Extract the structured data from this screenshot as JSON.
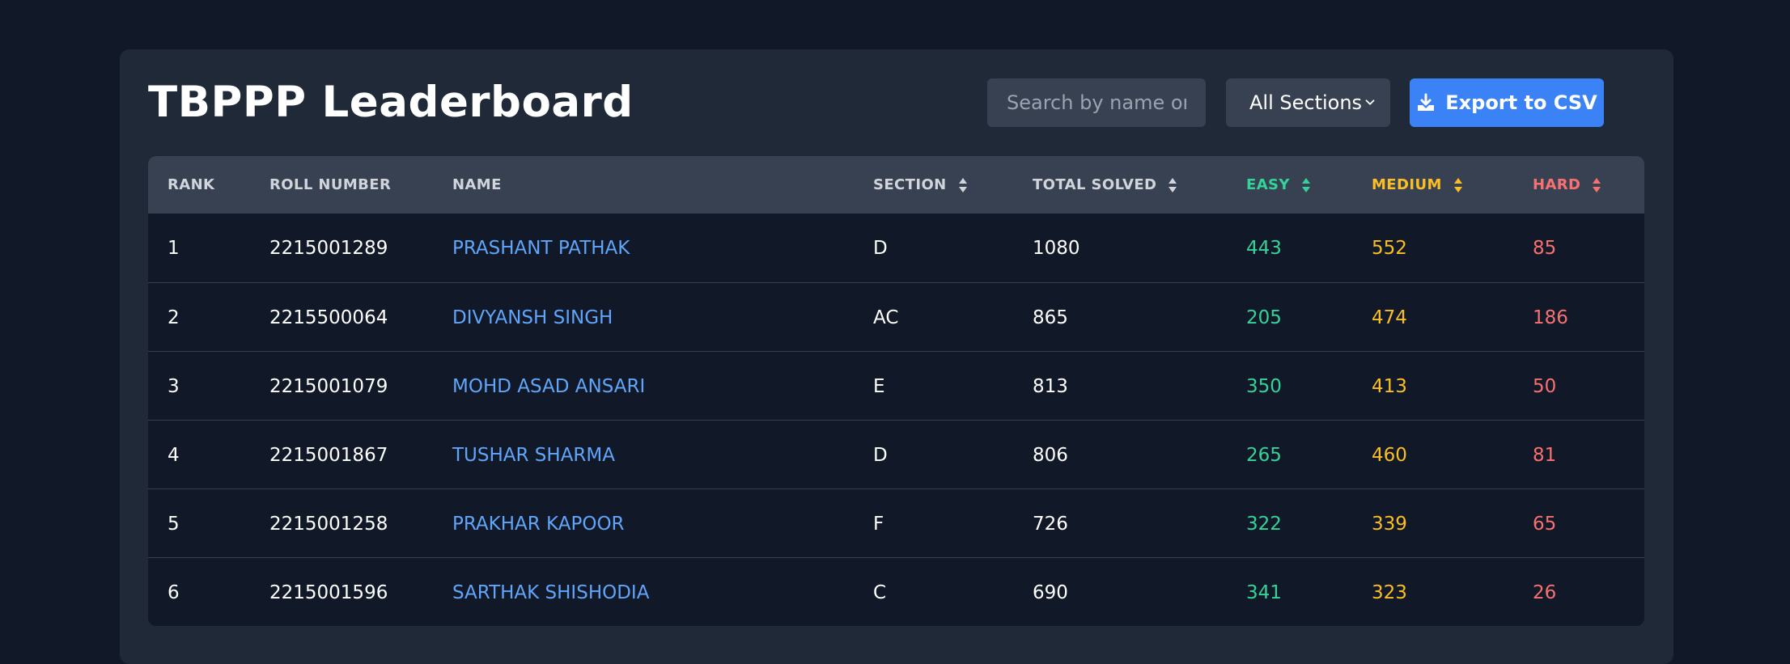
{
  "page": {
    "title": "TBPPP Leaderboard"
  },
  "toolbar": {
    "search_placeholder": "Search by name or roll number",
    "section_select": "All Sections",
    "export_label": "Export to CSV"
  },
  "colors": {
    "easy": "#34d399",
    "medium": "#fbbf24",
    "hard": "#f87171",
    "accent": "#3b82f6",
    "link": "#60a5fa"
  },
  "table": {
    "headers": {
      "rank": "RANK",
      "roll": "ROLL NUMBER",
      "name": "NAME",
      "section": "SECTION",
      "total": "TOTAL SOLVED",
      "easy": "EASY",
      "medium": "MEDIUM",
      "hard": "HARD"
    },
    "rows": [
      {
        "rank": "1",
        "roll": "2215001289",
        "name": "PRASHANT PATHAK",
        "section": "D",
        "total": "1080",
        "easy": "443",
        "medium": "552",
        "hard": "85"
      },
      {
        "rank": "2",
        "roll": "2215500064",
        "name": "DIVYANSH SINGH",
        "section": "AC",
        "total": "865",
        "easy": "205",
        "medium": "474",
        "hard": "186"
      },
      {
        "rank": "3",
        "roll": "2215001079",
        "name": "MOHD ASAD ANSARI",
        "section": "E",
        "total": "813",
        "easy": "350",
        "medium": "413",
        "hard": "50"
      },
      {
        "rank": "4",
        "roll": "2215001867",
        "name": "TUSHAR SHARMA",
        "section": "D",
        "total": "806",
        "easy": "265",
        "medium": "460",
        "hard": "81"
      },
      {
        "rank": "5",
        "roll": "2215001258",
        "name": "PRAKHAR KAPOOR",
        "section": "F",
        "total": "726",
        "easy": "322",
        "medium": "339",
        "hard": "65"
      },
      {
        "rank": "6",
        "roll": "2215001596",
        "name": "SARTHAK SHISHODIA",
        "section": "C",
        "total": "690",
        "easy": "341",
        "medium": "323",
        "hard": "26"
      }
    ]
  }
}
